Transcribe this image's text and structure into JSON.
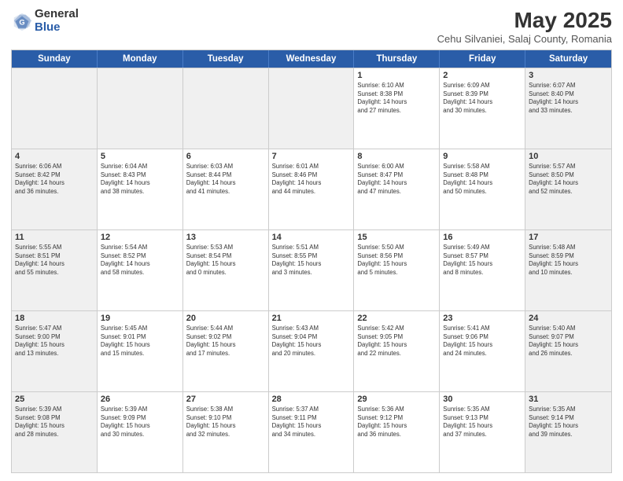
{
  "logo": {
    "general": "General",
    "blue": "Blue"
  },
  "title": "May 2025",
  "subtitle": "Cehu Silvaniei, Salaj County, Romania",
  "header_days": [
    "Sunday",
    "Monday",
    "Tuesday",
    "Wednesday",
    "Thursday",
    "Friday",
    "Saturday"
  ],
  "rows": [
    [
      {
        "day": "",
        "info": "",
        "shaded": true
      },
      {
        "day": "",
        "info": "",
        "shaded": true
      },
      {
        "day": "",
        "info": "",
        "shaded": true
      },
      {
        "day": "",
        "info": "",
        "shaded": true
      },
      {
        "day": "1",
        "info": "Sunrise: 6:10 AM\nSunset: 8:38 PM\nDaylight: 14 hours\nand 27 minutes."
      },
      {
        "day": "2",
        "info": "Sunrise: 6:09 AM\nSunset: 8:39 PM\nDaylight: 14 hours\nand 30 minutes."
      },
      {
        "day": "3",
        "info": "Sunrise: 6:07 AM\nSunset: 8:40 PM\nDaylight: 14 hours\nand 33 minutes.",
        "shaded": true
      }
    ],
    [
      {
        "day": "4",
        "info": "Sunrise: 6:06 AM\nSunset: 8:42 PM\nDaylight: 14 hours\nand 36 minutes.",
        "shaded": true
      },
      {
        "day": "5",
        "info": "Sunrise: 6:04 AM\nSunset: 8:43 PM\nDaylight: 14 hours\nand 38 minutes."
      },
      {
        "day": "6",
        "info": "Sunrise: 6:03 AM\nSunset: 8:44 PM\nDaylight: 14 hours\nand 41 minutes."
      },
      {
        "day": "7",
        "info": "Sunrise: 6:01 AM\nSunset: 8:46 PM\nDaylight: 14 hours\nand 44 minutes."
      },
      {
        "day": "8",
        "info": "Sunrise: 6:00 AM\nSunset: 8:47 PM\nDaylight: 14 hours\nand 47 minutes."
      },
      {
        "day": "9",
        "info": "Sunrise: 5:58 AM\nSunset: 8:48 PM\nDaylight: 14 hours\nand 50 minutes."
      },
      {
        "day": "10",
        "info": "Sunrise: 5:57 AM\nSunset: 8:50 PM\nDaylight: 14 hours\nand 52 minutes.",
        "shaded": true
      }
    ],
    [
      {
        "day": "11",
        "info": "Sunrise: 5:55 AM\nSunset: 8:51 PM\nDaylight: 14 hours\nand 55 minutes.",
        "shaded": true
      },
      {
        "day": "12",
        "info": "Sunrise: 5:54 AM\nSunset: 8:52 PM\nDaylight: 14 hours\nand 58 minutes."
      },
      {
        "day": "13",
        "info": "Sunrise: 5:53 AM\nSunset: 8:54 PM\nDaylight: 15 hours\nand 0 minutes."
      },
      {
        "day": "14",
        "info": "Sunrise: 5:51 AM\nSunset: 8:55 PM\nDaylight: 15 hours\nand 3 minutes."
      },
      {
        "day": "15",
        "info": "Sunrise: 5:50 AM\nSunset: 8:56 PM\nDaylight: 15 hours\nand 5 minutes."
      },
      {
        "day": "16",
        "info": "Sunrise: 5:49 AM\nSunset: 8:57 PM\nDaylight: 15 hours\nand 8 minutes."
      },
      {
        "day": "17",
        "info": "Sunrise: 5:48 AM\nSunset: 8:59 PM\nDaylight: 15 hours\nand 10 minutes.",
        "shaded": true
      }
    ],
    [
      {
        "day": "18",
        "info": "Sunrise: 5:47 AM\nSunset: 9:00 PM\nDaylight: 15 hours\nand 13 minutes.",
        "shaded": true
      },
      {
        "day": "19",
        "info": "Sunrise: 5:45 AM\nSunset: 9:01 PM\nDaylight: 15 hours\nand 15 minutes."
      },
      {
        "day": "20",
        "info": "Sunrise: 5:44 AM\nSunset: 9:02 PM\nDaylight: 15 hours\nand 17 minutes."
      },
      {
        "day": "21",
        "info": "Sunrise: 5:43 AM\nSunset: 9:04 PM\nDaylight: 15 hours\nand 20 minutes."
      },
      {
        "day": "22",
        "info": "Sunrise: 5:42 AM\nSunset: 9:05 PM\nDaylight: 15 hours\nand 22 minutes."
      },
      {
        "day": "23",
        "info": "Sunrise: 5:41 AM\nSunset: 9:06 PM\nDaylight: 15 hours\nand 24 minutes."
      },
      {
        "day": "24",
        "info": "Sunrise: 5:40 AM\nSunset: 9:07 PM\nDaylight: 15 hours\nand 26 minutes.",
        "shaded": true
      }
    ],
    [
      {
        "day": "25",
        "info": "Sunrise: 5:39 AM\nSunset: 9:08 PM\nDaylight: 15 hours\nand 28 minutes.",
        "shaded": true
      },
      {
        "day": "26",
        "info": "Sunrise: 5:39 AM\nSunset: 9:09 PM\nDaylight: 15 hours\nand 30 minutes."
      },
      {
        "day": "27",
        "info": "Sunrise: 5:38 AM\nSunset: 9:10 PM\nDaylight: 15 hours\nand 32 minutes."
      },
      {
        "day": "28",
        "info": "Sunrise: 5:37 AM\nSunset: 9:11 PM\nDaylight: 15 hours\nand 34 minutes."
      },
      {
        "day": "29",
        "info": "Sunrise: 5:36 AM\nSunset: 9:12 PM\nDaylight: 15 hours\nand 36 minutes."
      },
      {
        "day": "30",
        "info": "Sunrise: 5:35 AM\nSunset: 9:13 PM\nDaylight: 15 hours\nand 37 minutes."
      },
      {
        "day": "31",
        "info": "Sunrise: 5:35 AM\nSunset: 9:14 PM\nDaylight: 15 hours\nand 39 minutes.",
        "shaded": true
      }
    ]
  ]
}
